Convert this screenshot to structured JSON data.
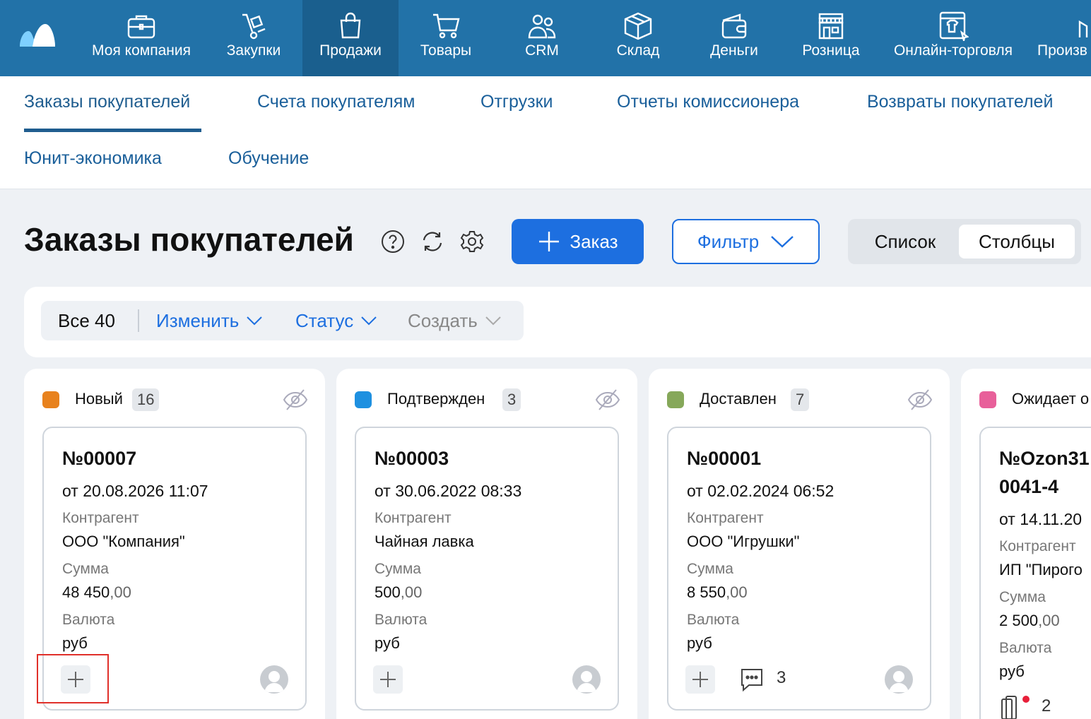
{
  "topnav": {
    "items": [
      {
        "label": "Моя компания",
        "icon": "briefcase-icon"
      },
      {
        "label": "Закупки",
        "icon": "hand-truck-icon"
      },
      {
        "label": "Продажи",
        "icon": "shopping-bag-icon"
      },
      {
        "label": "Товары",
        "icon": "cart-icon"
      },
      {
        "label": "CRM",
        "icon": "people-icon"
      },
      {
        "label": "Склад",
        "icon": "box-icon"
      },
      {
        "label": "Деньги",
        "icon": "wallet-icon"
      },
      {
        "label": "Розница",
        "icon": "store-icon"
      },
      {
        "label": "Онлайн-торговля",
        "icon": "online-store-icon"
      },
      {
        "label": "Произв",
        "icon": "factory-icon"
      }
    ],
    "active": "Продажи",
    "bg_color": "#2272a8"
  },
  "subnav": {
    "tabs": [
      {
        "label": "Заказы покупателей"
      },
      {
        "label": "Счета покупателям"
      },
      {
        "label": "Отгрузки"
      },
      {
        "label": "Отчеты комиссионера"
      },
      {
        "label": "Возвраты покупателей"
      },
      {
        "label": "Юнит-экономика"
      },
      {
        "label": "Обучение"
      }
    ],
    "active": "Заказы покупателей"
  },
  "header": {
    "title": "Заказы покупателей",
    "add_button": "Заказ",
    "filter_button": "Фильтр",
    "view_list": "Список",
    "view_columns": "Столбцы",
    "view_selected": "Столбцы"
  },
  "toolbar": {
    "all_label": "Все 40",
    "edit_label": "Изменить",
    "status_label": "Статус",
    "create_label": "Создать"
  },
  "columns": [
    {
      "title": "Новый",
      "count": "16",
      "color": "#e8821e",
      "card": {
        "number": "№00007",
        "date": "от 20.08.2026 11:07",
        "counterparty_label": "Контрагент",
        "counterparty": "ООО \"Компания\"",
        "sum_label": "Сумма",
        "sum_int": "48 450",
        "sum_dec": ",00",
        "currency_label": "Валюта",
        "currency": "руб"
      }
    },
    {
      "title": "Подтвержден",
      "count": "3",
      "color": "#1e90e0",
      "card": {
        "number": "№00003",
        "date": "от 30.06.2022 08:33",
        "counterparty_label": "Контрагент",
        "counterparty": "Чайная лавка",
        "sum_label": "Сумма",
        "sum_int": "500",
        "sum_dec": ",00",
        "currency_label": "Валюта",
        "currency": "руб"
      }
    },
    {
      "title": "Доставлен",
      "count": "7",
      "color": "#86a85a",
      "card": {
        "number": "№00001",
        "date": "от 02.02.2024 06:52",
        "counterparty_label": "Контрагент",
        "counterparty": "ООО \"Игрушки\"",
        "sum_label": "Сумма",
        "sum_int": "8 550",
        "sum_dec": ",00",
        "currency_label": "Валюта",
        "currency": "руб",
        "comments": "3"
      }
    },
    {
      "title": "Ожидает о",
      "color": "#e8609a",
      "card": {
        "number_line1": "№Ozon31",
        "number_line2": "0041-4",
        "date": "от 14.11.20",
        "counterparty_label": "Контрагент",
        "counterparty": "ИП \"Пирого",
        "sum_label": "Сумма",
        "sum_int": "2 500",
        "sum_dec": ",00",
        "currency_label": "Валюта",
        "currency": "руб",
        "attachments": "2"
      }
    }
  ]
}
